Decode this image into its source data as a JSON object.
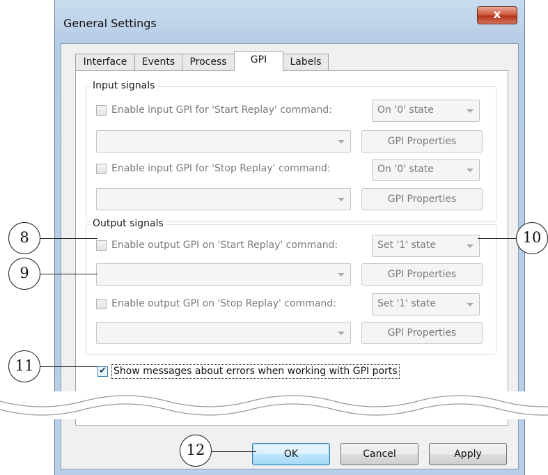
{
  "window": {
    "title": "General Settings",
    "close_label": "x"
  },
  "tabs": [
    {
      "label": "Interface"
    },
    {
      "label": "Events"
    },
    {
      "label": "Process"
    },
    {
      "label": "GPI",
      "active": true
    },
    {
      "label": "Labels"
    }
  ],
  "input_signals": {
    "title": "Input signals",
    "start": {
      "label": "Enable input GPI for 'Start Replay' command:",
      "checked": false,
      "state": "On '0' state",
      "port": "",
      "properties": "GPI Properties"
    },
    "stop": {
      "label": "Enable input GPI for 'Stop Replay' command:",
      "checked": false,
      "state": "On '0' state",
      "port": "",
      "properties": "GPI Properties"
    }
  },
  "output_signals": {
    "title": "Output signals",
    "start": {
      "label": "Enable output GPI on 'Start Replay' command:",
      "checked": false,
      "state": "Set '1' state",
      "port": "",
      "properties": "GPI Properties"
    },
    "stop": {
      "label": "Enable output GPI on 'Stop Replay' command:",
      "checked": false,
      "state": "Set '1' state",
      "port": "",
      "properties": "GPI Properties"
    }
  },
  "show_errors": {
    "label": "Show messages about errors when working with GPI ports",
    "checked": true,
    "check_glyph": "✔"
  },
  "buttons": {
    "ok": "OK",
    "cancel": "Cancel",
    "apply": "Apply"
  },
  "callouts": {
    "c8": "8",
    "c9": "9",
    "c10": "10",
    "c11": "11",
    "c12": "12"
  },
  "colors": {
    "accent": "#3c7fb1",
    "close": "#c44327",
    "disabled_text": "#7a7a7a"
  }
}
